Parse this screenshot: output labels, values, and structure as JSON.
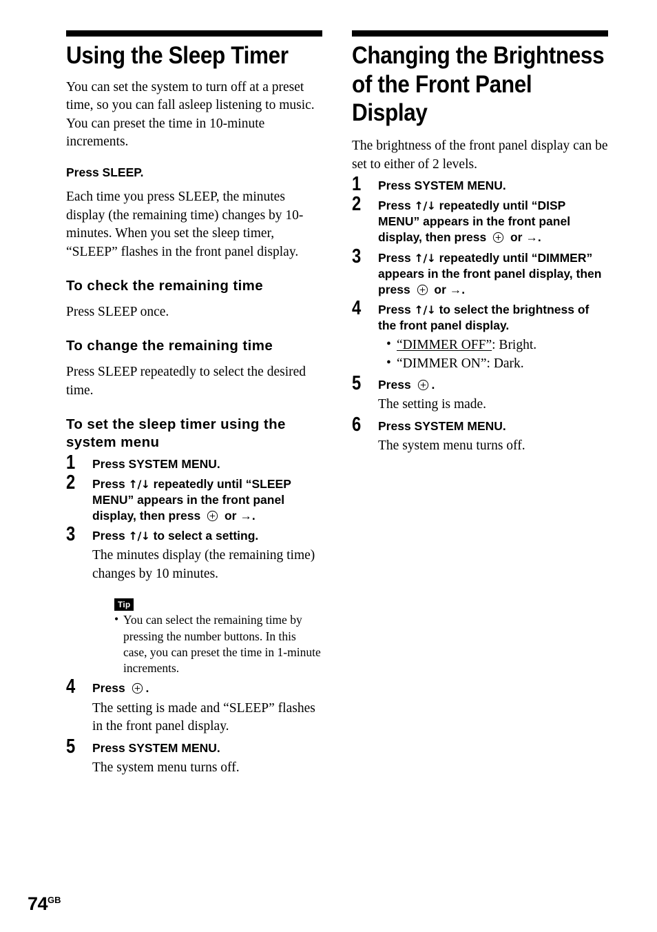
{
  "page": {
    "number": "74",
    "region_code": "GB"
  },
  "icons": {
    "enter_button": "enter-circle-plus-icon",
    "up_down": "↑/↓",
    "right_arrow": "→"
  },
  "left_column": {
    "title": "Using the Sleep Timer",
    "intro": "You can set the system to turn off at a preset time, so you can fall asleep listening to music. You can preset the time in 10-minute increments.",
    "press_sleep_heading": "Press SLEEP.",
    "press_sleep_body": "Each time you press SLEEP, the minutes display (the remaining time) changes by 10-minutes. When you set the sleep timer, “SLEEP” flashes in the front panel display.",
    "check_heading": "To check the remaining time",
    "check_body": "Press SLEEP once.",
    "change_heading": "To change the remaining time",
    "change_body": "Press SLEEP repeatedly to select the desired time.",
    "system_menu_heading": "To set the sleep timer using the system menu",
    "steps": [
      {
        "num": "1",
        "head_pre": "Press SYSTEM MENU.",
        "head_post": "",
        "note": ""
      },
      {
        "num": "2",
        "head_pre": "Press ",
        "head_mid": " repeatedly until “SLEEP MENU” appears in the front panel display, then press ",
        "head_post": " or →.",
        "note": ""
      },
      {
        "num": "3",
        "head_pre": "Press ",
        "head_post": " to select a setting.",
        "note": "The minutes display (the remaining time) changes by 10 minutes."
      },
      {
        "num": "4",
        "head_pre": "Press ",
        "head_post": ".",
        "note": "The setting is made and “SLEEP” flashes in the front panel display."
      },
      {
        "num": "5",
        "head_pre": "Press SYSTEM MENU.",
        "head_post": "",
        "note": "The system menu turns off."
      }
    ],
    "tip": {
      "label": "Tip",
      "items": [
        "You can select the remaining time by pressing the number buttons. In this case, you can preset the time in 1-minute increments."
      ]
    }
  },
  "right_column": {
    "title": "Changing the Brightness of the Front Panel Display",
    "intro": "The brightness of the front panel display can be set to either of 2 levels.",
    "steps": [
      {
        "num": "1",
        "head_pre": "Press SYSTEM MENU.",
        "head_post": "",
        "note": ""
      },
      {
        "num": "2",
        "head_pre": "Press ",
        "head_mid": " repeatedly until “DISP MENU” appears in the front panel display, then press ",
        "head_post": " or →.",
        "note": ""
      },
      {
        "num": "3",
        "head_pre": "Press ",
        "head_mid": " repeatedly until “DIMMER” appears in the front panel display, then press ",
        "head_post": " or →.",
        "note": ""
      },
      {
        "num": "4",
        "head_pre": "Press ",
        "head_post": " to select the brightness of the front panel display.",
        "note": "",
        "bullets": [
          {
            "quoted": "“DIMMER OFF”",
            "rest": ": Bright."
          },
          {
            "quoted": "“DIMMER ON”",
            "rest": ": Dark."
          }
        ]
      },
      {
        "num": "5",
        "head_pre": "Press ",
        "head_post": ".",
        "note": "The setting is made."
      },
      {
        "num": "6",
        "head_pre": "Press SYSTEM MENU.",
        "head_post": "",
        "note": "The system menu turns off."
      }
    ]
  }
}
